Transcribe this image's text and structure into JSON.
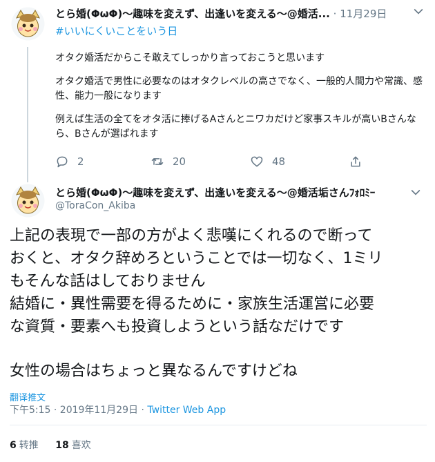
{
  "tweet1": {
    "display_name": "とら婚(ΦωΦ)～趣味を変えず、出逢いを変える～@婚活...",
    "separator": "·",
    "date": "11月29日",
    "hashtag": "#いいにくいことをいう日",
    "paragraphs": [
      "オタク婚活だからこそ敢えてしっかり言っておこうと思います",
      "オタク婚活で男性に必要なのはオタクレベルの高さでなく、一般的人間力や常識、感性、能力一般になります",
      "例えば生活の全てをオタ活に捧げるAさんとニワカだけど家事スキルが高いBさんなら、Bさんが選ばれます"
    ],
    "replies": "2",
    "retweets": "20",
    "likes": "48"
  },
  "tweet2": {
    "display_name": "とら婚(ΦωΦ)～趣味を変えず、出逢いを変える～@婚活垢さんﾌｫﾛﾐｰ",
    "handle": "@ToraCon_Akiba",
    "lines": [
      "上記の表現で一部の方がよく悲嘆にくれるので断って",
      "おくと、オタク辞めろということでは一切なく、1ミリ",
      "もそんな話はしておりません",
      "結婚に・異性需要を得るために・家族生活運営に必要",
      "な資質・要素へも投資しようという話なだけです"
    ],
    "last_line": "女性の場合はちょっと異なるんですけどね",
    "translate": "翻译推文",
    "time": "下午5:15 · 2019年11月29日 · ",
    "source": "Twitter Web App",
    "retweet_count": "6",
    "retweet_label": "转推",
    "like_count": "18",
    "like_label": "喜欢"
  },
  "colors": {
    "accent": "#1b95e0",
    "secondary_text": "#657786",
    "primary_text": "#14171a",
    "thread_line": "#ccd6dd"
  }
}
